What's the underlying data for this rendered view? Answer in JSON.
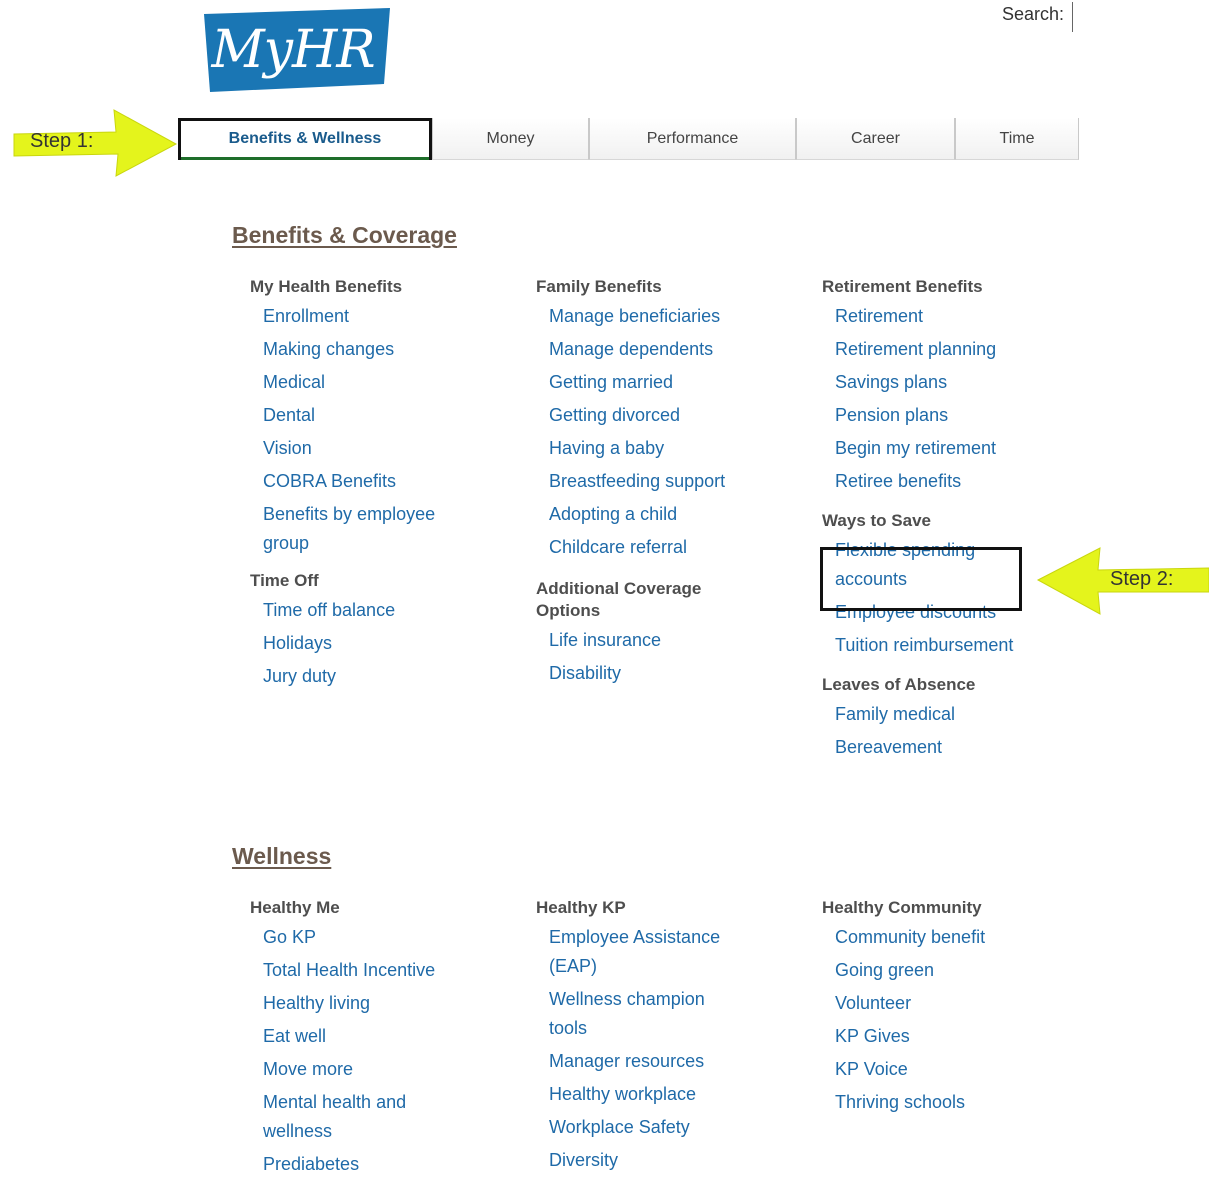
{
  "logo": {
    "text": "MyHR",
    "color": "#1a76b4"
  },
  "search": {
    "label": "Search:",
    "value": ""
  },
  "tabs": [
    {
      "label": "Benefits & Wellness",
      "active": true
    },
    {
      "label": "Money"
    },
    {
      "label": "Performance"
    },
    {
      "label": "Career"
    },
    {
      "label": "Time"
    }
  ],
  "callouts": {
    "step1": "Step 1:",
    "step2": "Step 2:",
    "arrow_color": "#e4f41c"
  },
  "benefits": {
    "title": "Benefits & Coverage",
    "col1": {
      "g1": {
        "title": "My Health Benefits",
        "links": [
          "Enrollment",
          "Making changes",
          "Medical",
          "Dental",
          "Vision",
          "COBRA Benefits",
          "Benefits by employee group"
        ]
      },
      "g2": {
        "title": "Time Off",
        "links": [
          "Time off balance",
          "Holidays",
          "Jury duty"
        ]
      }
    },
    "col2": {
      "g1": {
        "title": "Family Benefits",
        "links": [
          "Manage beneficiaries",
          "Manage dependents",
          "Getting married",
          "Getting divorced",
          "Having a baby",
          "Breastfeeding support",
          "Adopting a child",
          "Childcare referral"
        ]
      },
      "g2": {
        "title": "Additional Coverage Options",
        "links": [
          "Life insurance",
          "Disability"
        ]
      }
    },
    "col3": {
      "g1": {
        "title": "Retirement Benefits",
        "links": [
          "Retirement",
          "Retirement planning",
          "Savings plans",
          "Pension plans",
          "Begin my retirement",
          "Retiree benefits"
        ]
      },
      "g2": {
        "title": "Ways to Save",
        "links": [
          "Flexible spending accounts",
          "Employee discounts",
          "Tuition reimbursement"
        ]
      },
      "g3": {
        "title": "Leaves of Absence",
        "links": [
          "Family medical",
          "Bereavement"
        ]
      }
    }
  },
  "wellness": {
    "title": "Wellness",
    "col1": {
      "title": "Healthy Me",
      "links": [
        "Go KP",
        "Total Health Incentive",
        "Healthy living",
        "Eat well",
        "Move more",
        "Mental health and wellness",
        "Prediabetes"
      ]
    },
    "col2": {
      "title": "Healthy KP",
      "links": [
        "Employee Assistance (EAP)",
        "Wellness champion tools",
        "Manager resources",
        "Healthy workplace",
        "Workplace Safety",
        "Diversity"
      ]
    },
    "col3": {
      "title": "Healthy Community",
      "links": [
        "Community benefit",
        "Going green",
        "Volunteer",
        "KP Gives",
        "KP Voice",
        "Thriving schools"
      ]
    }
  }
}
